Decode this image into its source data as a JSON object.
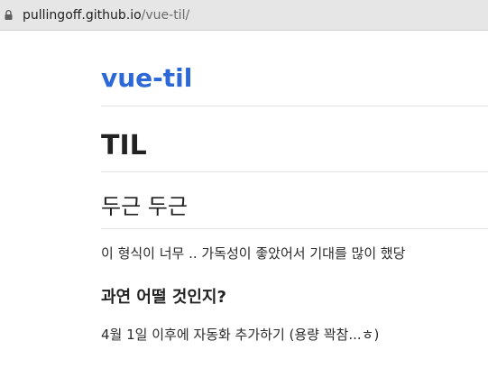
{
  "browser": {
    "url_host": "pullingoff.github.io",
    "url_path": "/vue-til/"
  },
  "site": {
    "title": "vue-til",
    "accent_color": "#2d68d8"
  },
  "content": {
    "h1": "TIL",
    "h2": "두근 두근",
    "paragraph_1": "이 형식이 너무 .. 가독성이 좋았어서 기대를 많이 했당",
    "h3": "과연 어떨 것인지?",
    "paragraph_2": "4월 1일 이후에 자동화 추가하기 (용량 꽉참...ㅎ)"
  },
  "icons": {
    "lock": "lock-icon"
  }
}
